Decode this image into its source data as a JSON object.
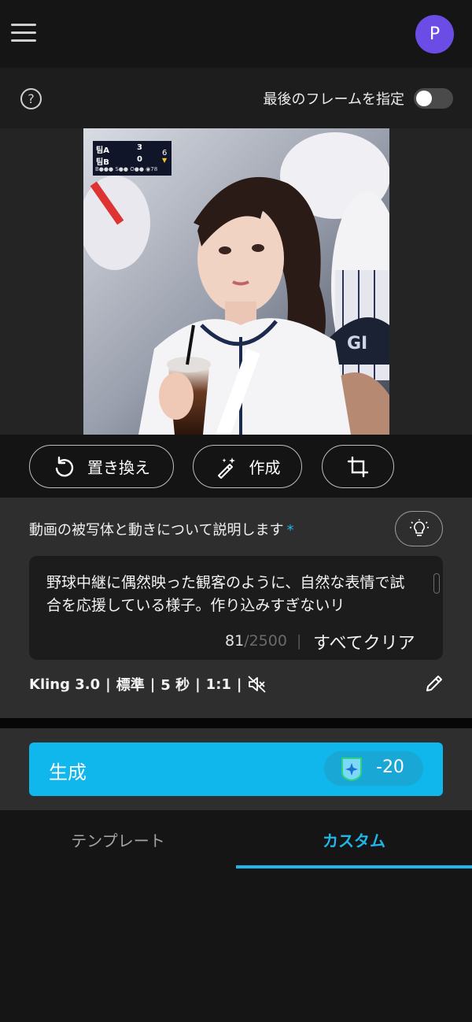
{
  "header": {
    "menu_icon": "hamburger-menu-icon",
    "avatar_initial": "P",
    "avatar_color": "#6b4de6"
  },
  "frame_bar": {
    "help_icon": "question-circle-icon",
    "help_glyph": "?",
    "last_frame_label": "最後のフレームを指定",
    "last_frame_enabled": false
  },
  "image": {
    "scoreboard": {
      "team_a": "팀A",
      "team_b": "팀B",
      "score_a": "3",
      "score_b": "0",
      "inning": "6",
      "inning_half": "▼",
      "count_line": "B●●● S●● O●● ◉78"
    }
  },
  "toolbar": {
    "replace_label": "置き換え",
    "replace_icon": "undo-arrow-icon",
    "create_label": "作成",
    "create_icon": "magic-wand-icon",
    "crop_icon": "crop-icon"
  },
  "prompt": {
    "title": "動画の被写体と動きについて説明します",
    "required_mark": "*",
    "ideas_icon": "lightbulb-icon",
    "text": "野球中継に偶然映った観客のように、自然な表情で試合を応援している様子。作り込みすぎないリ",
    "char_count": "81",
    "char_max": "/2500",
    "separator": "|",
    "clear_all": "すべてクリア"
  },
  "settings": {
    "model": "Kling 3.0",
    "quality": "標準",
    "duration": "5 秒",
    "ratio": "1:1",
    "bar": "|",
    "mute_icon": "speaker-muted-icon",
    "edit_icon": "pencil-icon"
  },
  "generate": {
    "label": "生成",
    "credit_icon": "credit-shield-icon",
    "credit_cost": "-20",
    "accent": "#0fb7ec"
  },
  "tabs": [
    {
      "label": "テンプレート",
      "active": false
    },
    {
      "label": "カスタム",
      "active": true
    }
  ]
}
